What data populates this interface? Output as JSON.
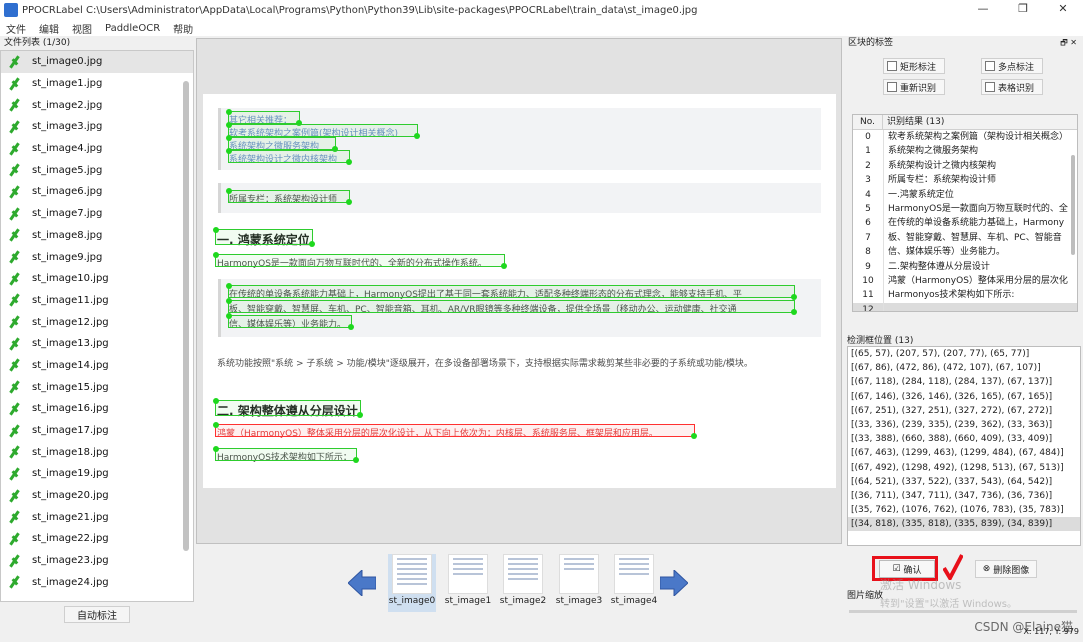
{
  "window": {
    "title": "PPOCRLabel C:\\Users\\Administrator\\AppData\\Local\\Programs\\Python\\Python39\\Lib\\site-packages\\PPOCRLabel\\train_data\\st_image0.jpg",
    "controls": [
      "—",
      "❐",
      "✕"
    ]
  },
  "menu": [
    "文件",
    "编辑",
    "视图",
    "PaddleOCR",
    "帮助"
  ],
  "file_list": {
    "title": "文件列表 (1/30)",
    "items": [
      "st_image0.jpg",
      "st_image1.jpg",
      "st_image2.jpg",
      "st_image3.jpg",
      "st_image4.jpg",
      "st_image5.jpg",
      "st_image6.jpg",
      "st_image7.jpg",
      "st_image8.jpg",
      "st_image9.jpg",
      "st_image10.jpg",
      "st_image11.jpg",
      "st_image12.jpg",
      "st_image13.jpg",
      "st_image14.jpg",
      "st_image15.jpg",
      "st_image16.jpg",
      "st_image17.jpg",
      "st_image18.jpg",
      "st_image19.jpg",
      "st_image20.jpg",
      "st_image21.jpg",
      "st_image22.jpg",
      "st_image23.jpg",
      "st_image24.jpg"
    ],
    "auto_label": "自动标注"
  },
  "document": {
    "quote1": [
      "其它相关推荐：",
      "软考系统架构之案例篇(架构设计相关概念)",
      "系统架构之微服务架构",
      "系统架构设计之微内核架构"
    ],
    "quote2": "所属专栏：系统架构设计师",
    "h1": "一. 鸿蒙系统定位",
    "p1": "HarmonyOS是一款面向万物互联时代的、全新的分布式操作系统。",
    "quote3": [
      "在传统的单设备系统能力基础上，HarmonyOS提出了基于同一套系统能力、适配多种终端形态的分布式理念，能够支持手机、平",
      "板、智能穿戴、智慧屏、车机、PC、智能音箱、耳机、AR/VR眼镜等多种终端设备，提供全场景（移动办公、运动健康、社交通",
      "信、媒体娱乐等）业务能力。"
    ],
    "p2": "系统功能按照\"系统 > 子系统 > 功能/模块\"逐级展开，在多设备部署场景下，支持根据实际需求裁剪某些非必要的子系统或功能/模块。",
    "h2": "二. 架构整体遵从分层设计",
    "p3": "鸿蒙（HarmonyOS）整体采用分层的层次化设计，从下向上依次为：内核层、系统服务层、框架层和应用层。",
    "p4": "HarmonyOS技术架构如下所示："
  },
  "thumbnails": [
    "st_image0",
    "st_image1",
    "st_image2",
    "st_image3",
    "st_image4"
  ],
  "right_panel": {
    "title": "区块的标签",
    "buttons": {
      "rect": "矩形标注",
      "poly": "多点标注",
      "rerec": "重新识别",
      "table": "表格识别"
    },
    "rec_header": {
      "no": "No.",
      "result": "识别结果 (13)"
    },
    "rec_rows": [
      "软考系统架构之案例篇（架构设计相关概念）",
      "系统架构之微服务架构",
      "系统架构设计之微内核架构",
      "所属专栏：系统架构设计师",
      "一.鸿蒙系统定位",
      "HarmonyOS是一款面向万物互联时代的、全",
      "在传统的单设备系统能力基础上，Harmony",
      "板、智能穿戴、智慧屏、车机、PC、智能音",
      "信、媒体娱乐等）业务能力。",
      "二.架构整体遵从分层设计",
      "鸿蒙（HarmonyOS）整体采用分层的层次化",
      "Harmonyos技术架构如下所示:",
      ""
    ],
    "box_title": "检测框位置 (13)",
    "box_rows": [
      "[(65, 57), (207, 57), (207, 77), (65, 77)]",
      "[(67, 86), (472, 86), (472, 107), (67, 107)]",
      "[(67, 118), (284, 118), (284, 137), (67, 137)]",
      "[(67, 146), (326, 146), (326, 165), (67, 165)]",
      "[(67, 251), (327, 251), (327, 272), (67, 272)]",
      "[(33, 336), (239, 335), (239, 362), (33, 363)]",
      "[(33, 388), (660, 388), (660, 409), (33, 409)]",
      "[(67, 463), (1299, 463), (1299, 484), (67, 484)]",
      "[(67, 492), (1298, 492), (1298, 513), (67, 513)]",
      "[(64, 521), (337, 522), (337, 543), (64, 542)]",
      "[(36, 711), (347, 711), (347, 736), (36, 736)]",
      "[(35, 762), (1076, 762), (1076, 783), (35, 783)]",
      "[(34, 818), (335, 818), (335, 839), (34, 839)]"
    ],
    "confirm": "确认",
    "delete": "删除图像",
    "zoom_title": "图片缩放"
  },
  "watermark": {
    "line1": "激活 Windows",
    "line2": "转到\"设置\"以激活 Windows。"
  },
  "status": "X: 117; Y: 979",
  "csdn": "CSDN @Elaine猫"
}
